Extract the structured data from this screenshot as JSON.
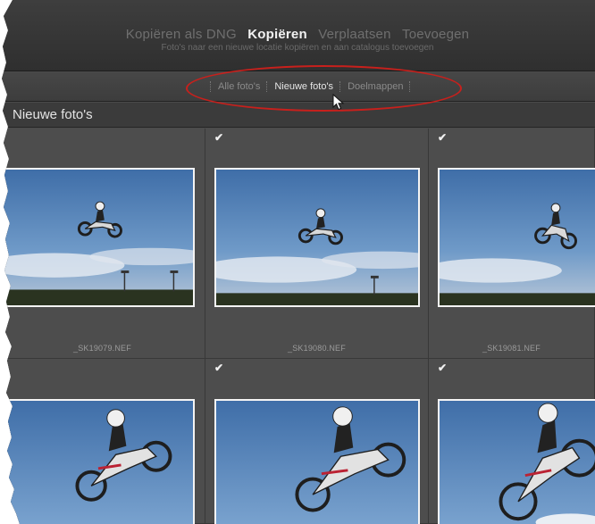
{
  "modes": {
    "items": [
      "Kopiëren als DNG",
      "Kopiëren",
      "Verplaatsen",
      "Toevoegen"
    ],
    "active": "Kopiëren",
    "description": "Foto's naar een nieuwe locatie kopiëren en aan catalogus toevoegen"
  },
  "filters": {
    "items": [
      "Alle foto's",
      "Nieuwe foto's",
      "Doelmappen"
    ],
    "active": "Nieuwe foto's"
  },
  "header": {
    "title": "Nieuwe foto's"
  },
  "photos": [
    {
      "filename": "_SK19079.NEF",
      "checked": false
    },
    {
      "filename": "_SK19080.NEF",
      "checked": true
    },
    {
      "filename": "_SK19081.NEF",
      "checked": true
    },
    {
      "filename": "",
      "checked": false
    },
    {
      "filename": "",
      "checked": true
    },
    {
      "filename": "",
      "checked": true
    }
  ],
  "colors": {
    "annotation": "#c8201c",
    "active_text": "#f2f2f2",
    "sky": "#4f7fb8"
  }
}
